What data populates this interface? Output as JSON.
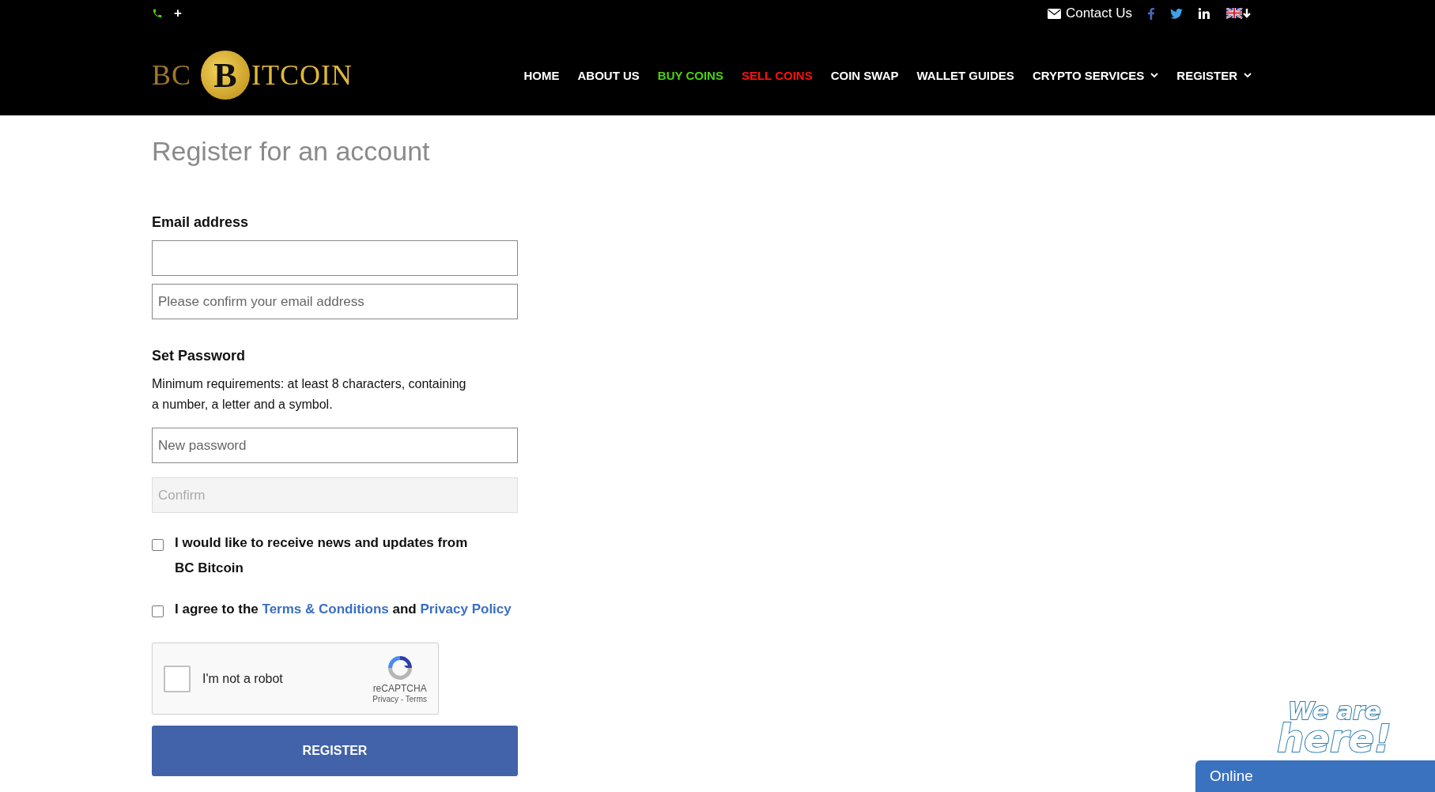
{
  "topbar": {
    "phone": "+",
    "contact": "Contact Us"
  },
  "logo": {
    "left": "BC",
    "coin": "B",
    "right": "ITCOIN"
  },
  "nav": [
    {
      "label": "HOME",
      "color": "#ffffff",
      "dropdown": false
    },
    {
      "label": "ABOUT US",
      "color": "#ffffff",
      "dropdown": false
    },
    {
      "label": "BUY COINS",
      "color": "#4cd20a",
      "dropdown": false
    },
    {
      "label": "SELL COINS",
      "color": "#ff1010",
      "dropdown": false
    },
    {
      "label": "COIN SWAP",
      "color": "#ffffff",
      "dropdown": false
    },
    {
      "label": "WALLET GUIDES",
      "color": "#ffffff",
      "dropdown": false
    },
    {
      "label": "CRYPTO SERVICES",
      "color": "#ffffff",
      "dropdown": true
    },
    {
      "label": "REGISTER",
      "color": "#ffffff",
      "dropdown": true
    }
  ],
  "page_title": "Register for an account",
  "email": {
    "label": "Email address",
    "fields": [
      {
        "disabled": false
      },
      {
        "placeholder": "Please confirm your email address",
        "disabled": false
      }
    ]
  },
  "password": {
    "label": "Set Password",
    "hint_lines": [
      "Minimum requirements: at least 8 characters, containing",
      "a number, a letter and a symbol."
    ],
    "fields": [
      {
        "placeholder": "New password",
        "disabled": false
      },
      {
        "placeholder": "Confirm",
        "disabled": true
      }
    ]
  },
  "consents": [
    {
      "checked": false,
      "lines": [
        "I would like to receive news and updates from",
        "BC Bitcoin"
      ]
    },
    {
      "checked": false,
      "parts": [
        {
          "kind": "text",
          "text": "I agree to the "
        },
        {
          "kind": "link",
          "text": "Terms & Conditions"
        },
        {
          "kind": "text",
          "text": " and "
        },
        {
          "kind": "link",
          "text": "Privacy Policy"
        }
      ]
    }
  ],
  "captcha": {
    "label": "I'm not a robot",
    "checked": false,
    "brand": "reCAPTCHA",
    "links": "Privacy - Terms"
  },
  "submit": "REGISTER",
  "chat": {
    "badge_top": "We are",
    "badge_bottom": "here!",
    "status": "Online"
  }
}
